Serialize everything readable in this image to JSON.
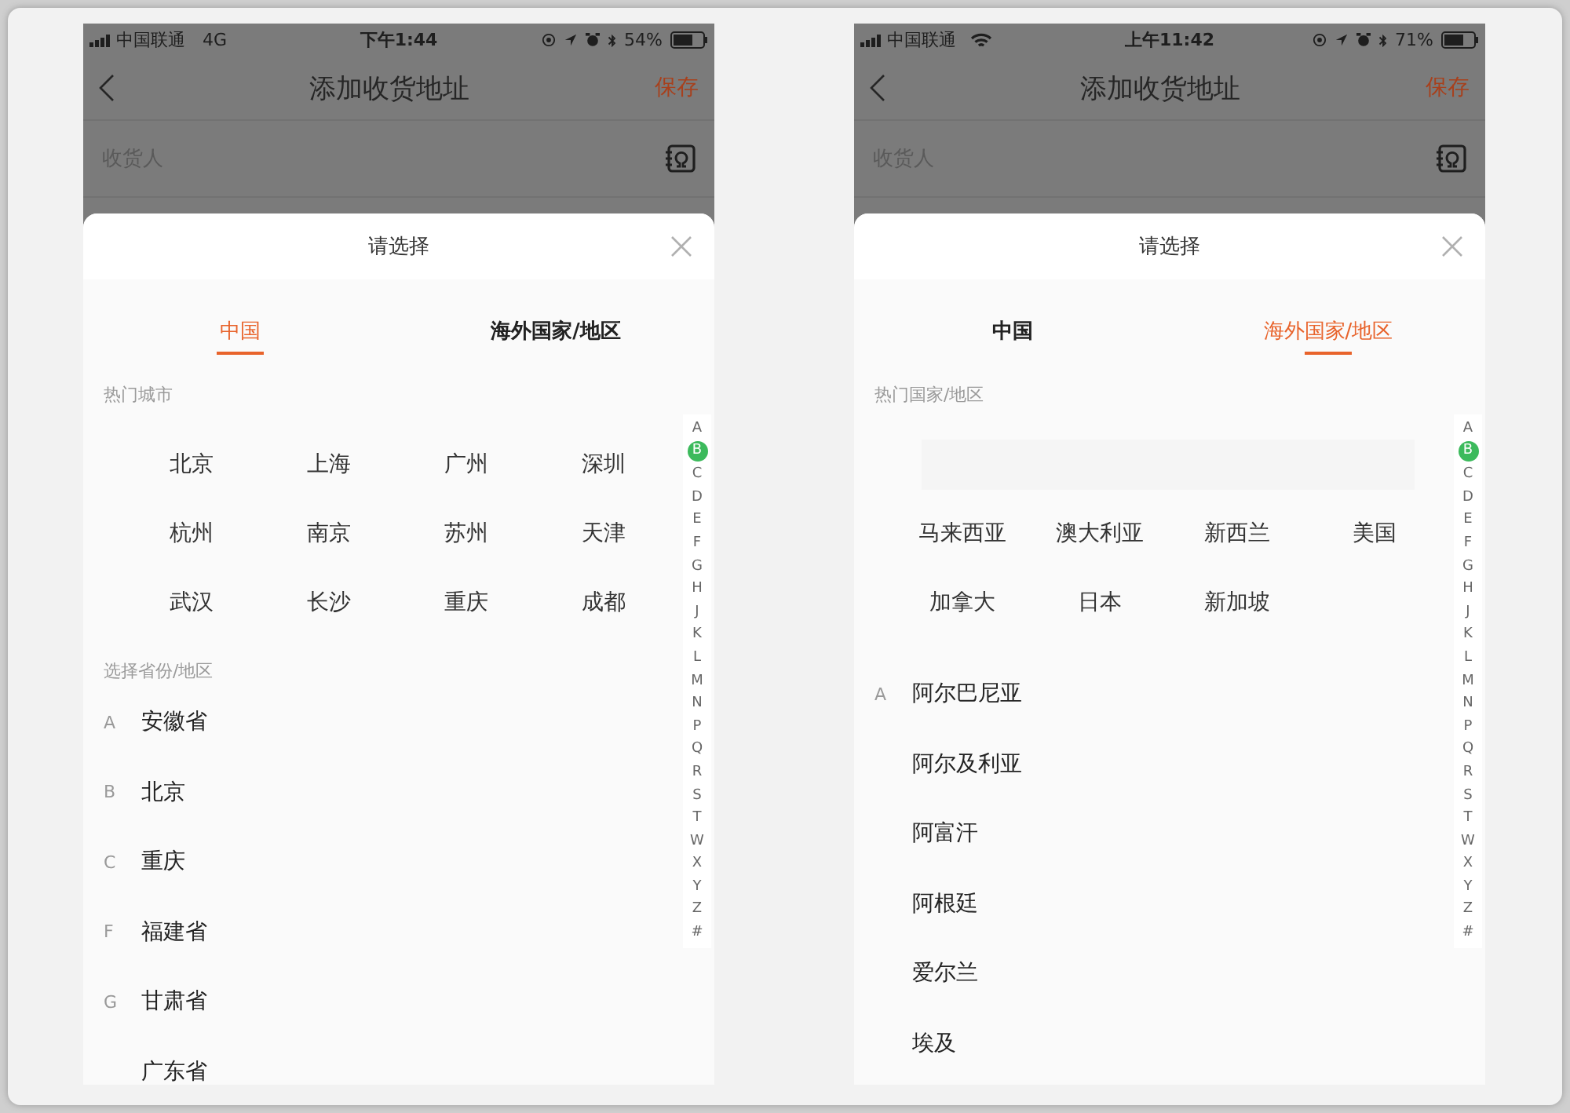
{
  "phones": [
    {
      "status_bar": {
        "carrier": "中国联通",
        "network": "4G",
        "time": "下午1:44",
        "battery": "54%"
      },
      "nav": {
        "title": "添加收货地址",
        "action": "保存"
      },
      "field": {
        "placeholder": "收货人"
      },
      "sheet": {
        "title": "请选择",
        "tabs": [
          {
            "label": "中国",
            "selected": true
          },
          {
            "label": "海外国家/地区",
            "selected": false
          }
        ],
        "hot_title": "热门城市",
        "hot_items": [
          "北京",
          "上海",
          "广州",
          "深圳",
          "杭州",
          "南京",
          "苏州",
          "天津",
          "武汉",
          "长沙",
          "重庆",
          "成都"
        ],
        "list_title": "选择省份/地区",
        "list": [
          {
            "letter": "A",
            "name": "安徽省"
          },
          {
            "letter": "B",
            "name": "北京"
          },
          {
            "letter": "C",
            "name": "重庆"
          },
          {
            "letter": "F",
            "name": "福建省"
          },
          {
            "letter": "G",
            "name": "甘肃省"
          },
          {
            "name": "广东省"
          }
        ],
        "index": [
          {
            "letter": "A",
            "selected": false
          },
          {
            "letter": "B",
            "selected": true
          },
          {
            "letter": "C",
            "selected": false
          },
          {
            "letter": "D",
            "selected": false
          },
          {
            "letter": "E",
            "selected": false
          },
          {
            "letter": "F",
            "selected": false
          },
          {
            "letter": "G",
            "selected": false
          },
          {
            "letter": "H",
            "selected": false
          },
          {
            "letter": "J",
            "selected": false
          },
          {
            "letter": "K",
            "selected": false
          },
          {
            "letter": "L",
            "selected": false
          },
          {
            "letter": "M",
            "selected": false
          },
          {
            "letter": "N",
            "selected": false
          },
          {
            "letter": "P",
            "selected": false
          },
          {
            "letter": "Q",
            "selected": false
          },
          {
            "letter": "R",
            "selected": false
          },
          {
            "letter": "S",
            "selected": false
          },
          {
            "letter": "T",
            "selected": false
          },
          {
            "letter": "W",
            "selected": false
          },
          {
            "letter": "X",
            "selected": false
          },
          {
            "letter": "Y",
            "selected": false
          },
          {
            "letter": "Z",
            "selected": false
          },
          {
            "letter": "#",
            "selected": false
          }
        ]
      }
    },
    {
      "status_bar": {
        "carrier": "中国联通",
        "wifi": true,
        "time": "上午11:42",
        "battery": "71%"
      },
      "nav": {
        "title": "添加收货地址",
        "action": "保存"
      },
      "field": {
        "placeholder": "收货人"
      },
      "sheet": {
        "title": "请选择",
        "tabs": [
          {
            "label": "中国",
            "selected": false
          },
          {
            "label": "海外国家/地区",
            "selected": true
          }
        ],
        "hot_title": "热门国家/地区",
        "placeholder_row": true,
        "hot_items": [
          "马来西亚",
          "澳大利亚",
          "新西兰",
          "美国",
          "加拿大",
          "日本",
          "新加坡"
        ],
        "list": [
          {
            "letter": "A",
            "name": "阿尔巴尼亚"
          },
          {
            "name": "阿尔及利亚"
          },
          {
            "name": "阿富汗"
          },
          {
            "name": "阿根廷"
          },
          {
            "name": "爱尔兰"
          },
          {
            "name": "埃及"
          }
        ],
        "index": [
          {
            "letter": "A",
            "selected": false
          },
          {
            "letter": "B",
            "selected": true
          },
          {
            "letter": "C",
            "selected": false
          },
          {
            "letter": "D",
            "selected": false
          },
          {
            "letter": "E",
            "selected": false
          },
          {
            "letter": "F",
            "selected": false
          },
          {
            "letter": "G",
            "selected": false
          },
          {
            "letter": "H",
            "selected": false
          },
          {
            "letter": "J",
            "selected": false
          },
          {
            "letter": "K",
            "selected": false
          },
          {
            "letter": "L",
            "selected": false
          },
          {
            "letter": "M",
            "selected": false
          },
          {
            "letter": "N",
            "selected": false
          },
          {
            "letter": "P",
            "selected": false
          },
          {
            "letter": "Q",
            "selected": false
          },
          {
            "letter": "R",
            "selected": false
          },
          {
            "letter": "S",
            "selected": false
          },
          {
            "letter": "T",
            "selected": false
          },
          {
            "letter": "W",
            "selected": false
          },
          {
            "letter": "X",
            "selected": false
          },
          {
            "letter": "Y",
            "selected": false
          },
          {
            "letter": "Z",
            "selected": false
          },
          {
            "letter": "#",
            "selected": false
          }
        ]
      }
    }
  ]
}
